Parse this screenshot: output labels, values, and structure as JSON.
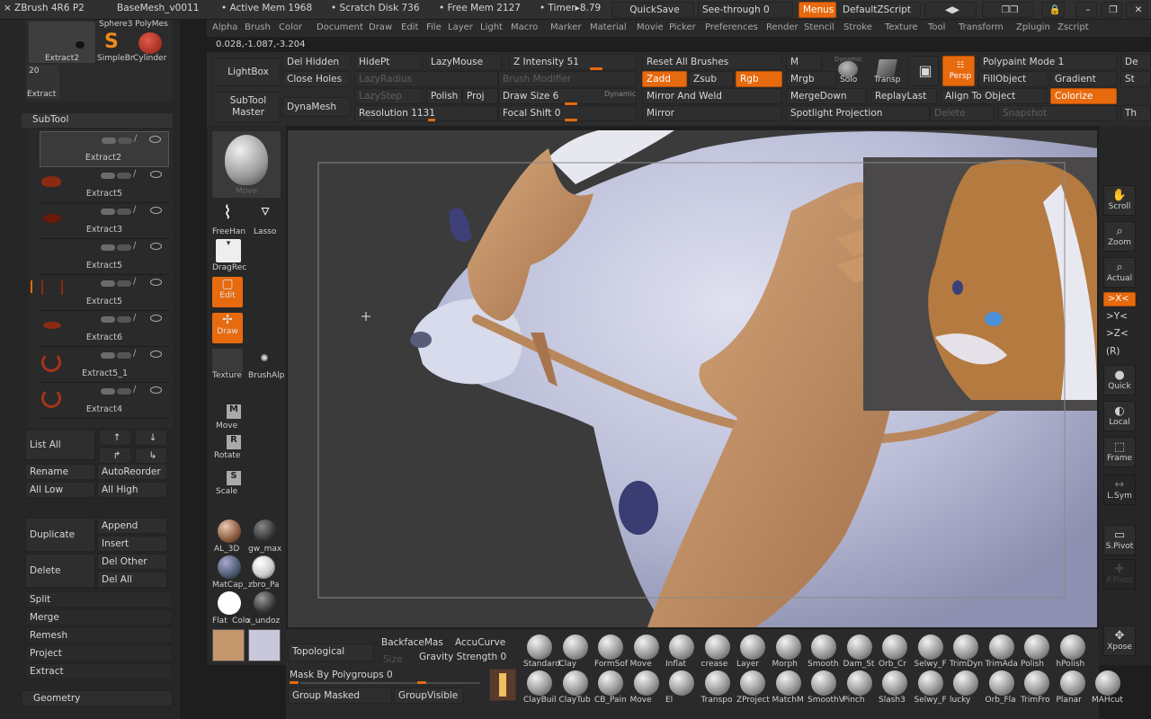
{
  "titlebar": {
    "app": "ZBrush 4R6 P2",
    "file": "BaseMesh_v0011",
    "active_mem": "• Active Mem 1968",
    "scratch": "• Scratch Disk 736",
    "free_mem": "• Free Mem 2127",
    "timer": "• Timer▸8.79",
    "quicksave": "QuickSave",
    "seethrough": "See-through  0",
    "menus": "Menus",
    "script": "DefaultZScript"
  },
  "menubar": [
    "Alpha",
    "Brush",
    "Color",
    "Document",
    "Draw",
    "Edit",
    "File",
    "Layer",
    "Light",
    "Macro",
    "Marker",
    "Material",
    "Movie",
    "Picker",
    "Preferences",
    "Render",
    "Stencil",
    "Stroke",
    "Texture",
    "Tool",
    "Transform",
    "Zplugin",
    "Zscript"
  ],
  "coords": "0.028,-1.087,-3.204",
  "toolthumbs": {
    "sphere": "Sphere3 PolyMes",
    "extract2": "Extract2",
    "simplebr": "SimpleBr",
    "cylinder": "Cylinder",
    "count": "20",
    "extract": "Extract"
  },
  "subtool": {
    "title": "SubTool",
    "items": [
      "Extract2",
      "Extract5",
      "Extract3",
      "Extract5",
      "Extract5",
      "Extract6",
      "Extract5_1",
      "Extract4"
    ],
    "list_all": "List All",
    "rename": "Rename",
    "autoreorder": "AutoReorder",
    "all_low": "All Low",
    "all_high": "All High",
    "duplicate": "Duplicate",
    "append": "Append",
    "insert": "Insert",
    "delete": "Delete",
    "del_other": "Del Other",
    "del_all": "Del All",
    "split": "Split",
    "merge": "Merge",
    "remesh": "Remesh",
    "project": "Project",
    "extract": "Extract",
    "geometry": "Geometry"
  },
  "toptools": {
    "lightbox": "LightBox",
    "subtool_master": "SubTool Master",
    "del_hidden": "Del Hidden",
    "hidept": "HidePt",
    "lazymouse": "LazyMouse",
    "close_holes": "Close Holes",
    "lazyradius": "LazyRadius",
    "lazystep": "LazyStep",
    "polish": "Polish 0",
    "proj": "Proj",
    "dynamesh": "DynaMesh",
    "resolution": "Resolution 1131",
    "z_intensity": "Z Intensity 51",
    "brush_modifier": "Brush Modifier",
    "draw_size": "Draw Size 6",
    "dynamic": "Dynamic",
    "focal_shift": "Focal Shift 0",
    "reset_brushes": "Reset All Brushes",
    "m": "M",
    "zadd": "Zadd",
    "zsub": "Zsub",
    "rgb": "Rgb",
    "mrgb": "Mrgb",
    "mirror_weld": "Mirror And Weld",
    "mergedown": "MergeDown",
    "mirror": "Mirror",
    "spotlight": "Spotlight Projection",
    "dynamic2": "Dynamic",
    "solo": "Solo",
    "transp": "Transp",
    "persp": "Persp",
    "replaylast": "ReplayLast",
    "delete": "Delete",
    "polypaint": "Polypaint Mode 1",
    "fillobject": "FillObject",
    "gradient": "Gradient",
    "align": "Align To Object",
    "colorize": "Colorize",
    "snapshot": "Snapshot",
    "de": "De",
    "st": "St",
    "th": "Th"
  },
  "leftshelf": {
    "move_thumb": "Move",
    "freehand": "FreeHan",
    "lasso": "Lasso",
    "dragrect": "DragRec",
    "edit": "Edit",
    "draw": "Draw",
    "texture": "Texture",
    "brushalpha": "BrushAlp",
    "move": "Move",
    "rotate": "Rotate",
    "scale": "Scale",
    "mats": [
      "AL_3D",
      "gw_max",
      "MatCap_",
      "zbro_Pa",
      "Flat",
      "Colo",
      "x_undoz"
    ]
  },
  "rightshelf": [
    "Scroll",
    "Zoom",
    "Actual",
    ">X<",
    ">Y<",
    ">Z<",
    "(R)",
    "Quick",
    "Local",
    "Frame",
    "L.Sym",
    "S.Pivot",
    "P.Pivot",
    "Xpose"
  ],
  "bottom": {
    "topological": "Topological",
    "backface": "BackfaceMas",
    "accucurve": "AccuCurve",
    "size": "Size",
    "gravity": "Gravity Strength 0",
    "mask_poly": "Mask By Polygroups 0",
    "group_masked": "Group Masked",
    "groupvisible": "GroupVisible",
    "brushes_top": [
      "Standard",
      "Clay",
      "FormSof",
      "Move",
      "Inflat",
      "crease",
      "Layer",
      "Morph",
      "Smooth",
      "Dam_St",
      "Orb_Cr",
      "Selwy_F",
      "TrimDyn",
      "TrimAda",
      "Polish",
      "hPolish"
    ],
    "brushes_bot": [
      "ClayBuil",
      "ClayTub",
      "CB_Pain",
      "Move",
      "El",
      "Transpo",
      "ZProject",
      "MatchM",
      "SmoothV",
      "Pinch",
      "Slash3",
      "Selwy_F",
      "lucky",
      "Orb_Fla",
      "TrimFro",
      "Planar",
      "MAHcut"
    ]
  },
  "colors": {
    "accent": "#e86a0e",
    "skin": "#c4966c",
    "fur": "#c6c9e0"
  }
}
